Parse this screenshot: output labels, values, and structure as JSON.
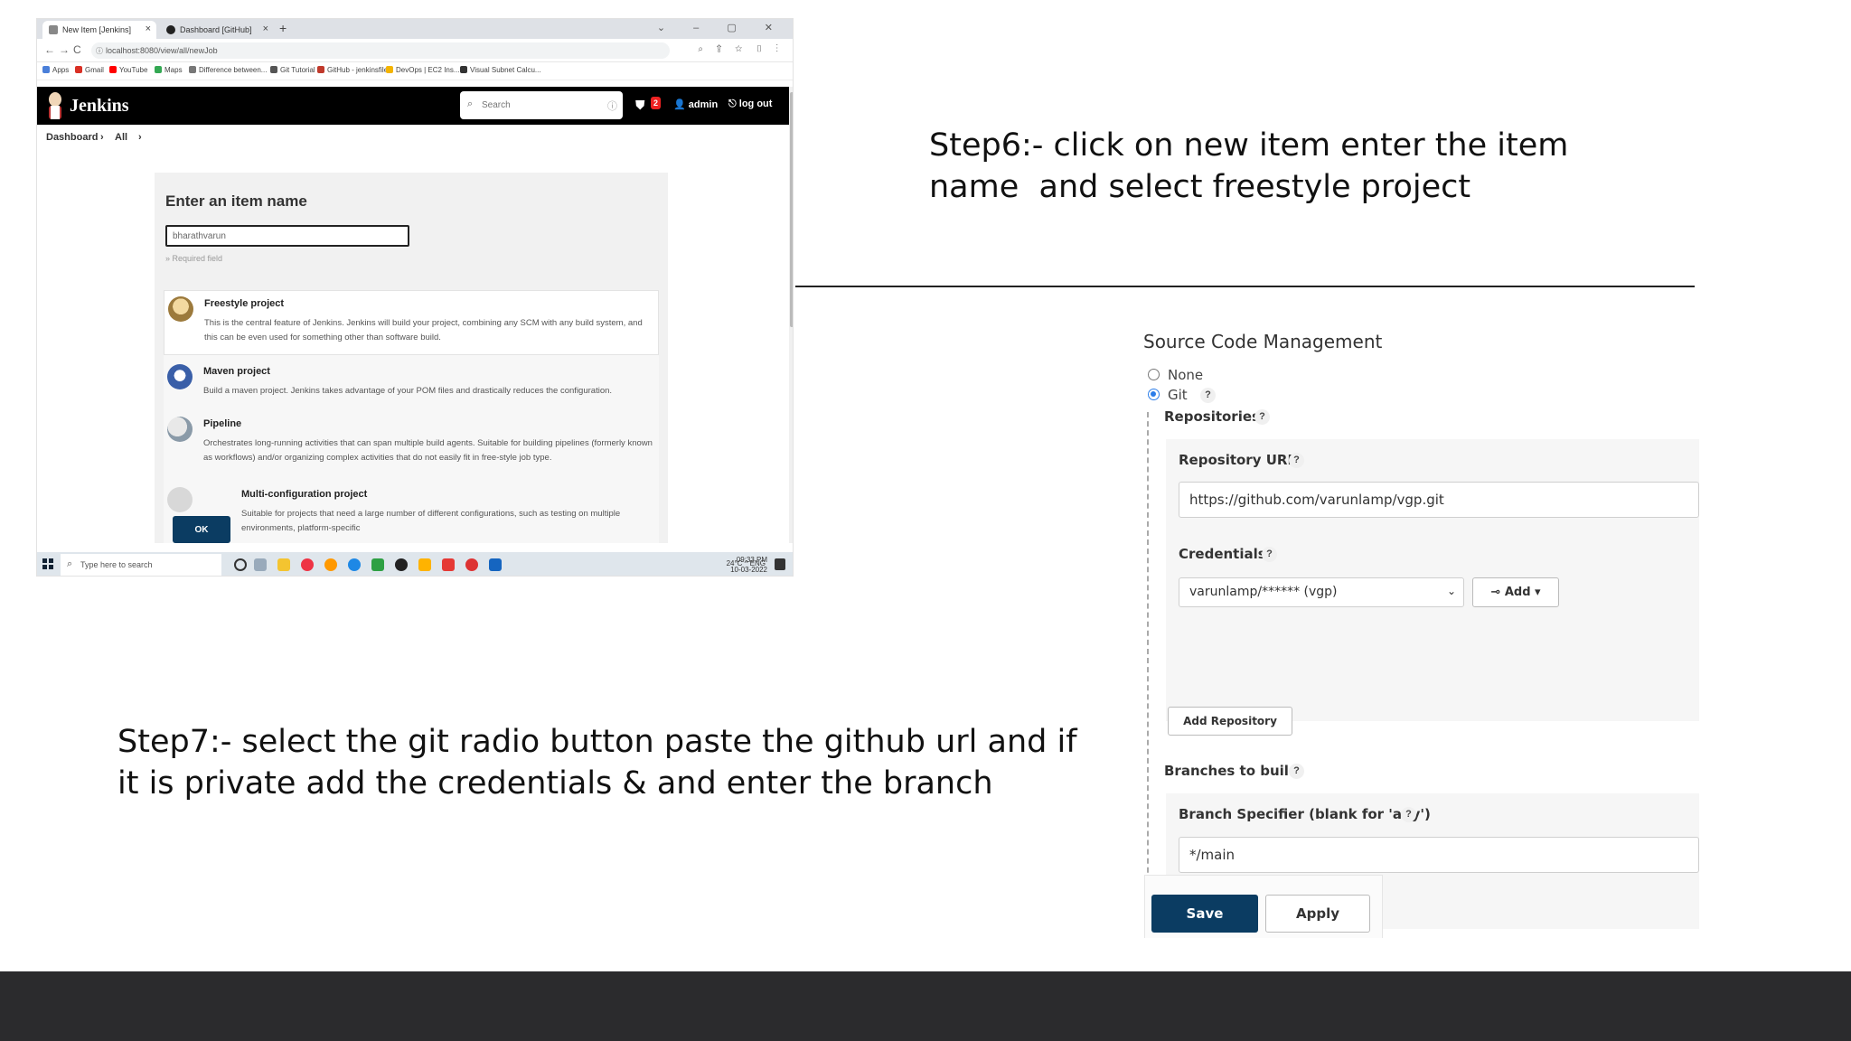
{
  "colors": {
    "jenkins_header": "#000000",
    "jenkins_button": "#0b3c62",
    "radio_selected": "#2b7de9",
    "footer_bar": "#2b2b2d"
  },
  "browser": {
    "tabs": [
      {
        "label": "New Item [Jenkins]",
        "close": "×"
      },
      {
        "label": "Dashboard [GitHub]",
        "close": "×"
      }
    ],
    "new_tab": "+",
    "window_controls": "⌄ – ▢ ✕",
    "nav_back": "←",
    "nav_forward": "→",
    "nav_reload": "C",
    "url": "localhost:8080/view/all/newJob",
    "toolbar_icons": "⌕ ⇪ ☆ ▯ ⋮",
    "bookmarks": [
      "Apps",
      "Gmail",
      "YouTube",
      "Maps",
      "Difference between...",
      "Git Tutorial",
      "GitHub - jenkinsfile",
      "DevOps | EC2 Ins...",
      "Visual Subnet Calcu..."
    ]
  },
  "jenkins": {
    "brand": "Jenkins",
    "search_placeholder": "Search",
    "search_icon": "search-icon",
    "alert_count": "2",
    "user": "admin",
    "logout": "log out",
    "breadcrumb": {
      "root": "Dashboard",
      "sep1": "›",
      "current": "All",
      "sep2": "›"
    },
    "new_item": {
      "heading": "Enter an item name",
      "item_name": "bharathvarun",
      "required_hint": "» Required field",
      "types": [
        {
          "name": "Freestyle project",
          "desc": "This is the central feature of Jenkins. Jenkins will build your project, combining any SCM with any build system, and this can be even used for something other than software build."
        },
        {
          "name": "Maven project",
          "desc": "Build a maven project. Jenkins takes advantage of your POM files and drastically reduces the configuration."
        },
        {
          "name": "Pipeline",
          "desc": "Orchestrates long-running activities that can span multiple build agents. Suitable for building pipelines (formerly known as workflows) and/or organizing complex activities that do not easily fit in free-style job type."
        },
        {
          "name": "Multi-configuration project",
          "desc": "Suitable for projects that need a large number of different configurations, such as testing on multiple environments, platform-specific"
        }
      ],
      "ok_label": "OK"
    }
  },
  "taskbar": {
    "search_placeholder": "Type here to search",
    "tray": "24°C  ^  ENG",
    "time": "09:33 PM",
    "date": "10-03-2022"
  },
  "captions": {
    "step6": "Step6:- click on new item enter the item\nname  and select freestyle project",
    "step7": "Step7:- select the git radio button paste the github url and if\nit is private add the credentials & and enter the branch"
  },
  "scm": {
    "title": "Source Code Management",
    "option_none": "None",
    "option_git": "Git",
    "help": "?",
    "repositories_label": "Repositories",
    "repo_url_label": "Repository URL",
    "repo_url_value": "https://github.com/varunlamp/vgp.git",
    "credentials_label": "Credentials",
    "credentials_value": "varunlamp/****** (vgp)",
    "credentials_caret": "⌄",
    "add_label": "Add",
    "add_repository_label": "Add Repository",
    "branches_label": "Branches to build",
    "branch_specifier_label": "Branch Specifier (blank for 'any')",
    "branch_value": "*/main",
    "save_label": "Save",
    "apply_label": "Apply"
  }
}
